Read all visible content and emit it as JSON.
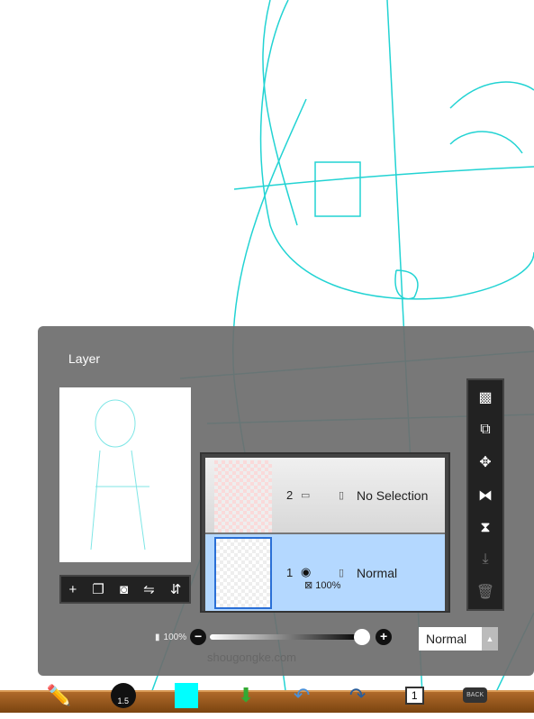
{
  "panel": {
    "title": "Layer"
  },
  "layers": [
    {
      "number": "2",
      "visibility_icon": "selection-rect-icon",
      "mode_icon": "page-icon",
      "name": "No Selection",
      "selected": false
    },
    {
      "number": "1",
      "visibility_icon": "eye-icon",
      "mode_icon": "page-icon",
      "name": "Normal",
      "opacity": "100%",
      "selected": true
    }
  ],
  "preview_tools": [
    "plus-icon",
    "copy-icon",
    "camera-icon",
    "flip-h-icon",
    "flip-v-icon"
  ],
  "side_tools": [
    "transparency-icon",
    "copy-layer-icon",
    "move-icon",
    "flip-horizontal-icon",
    "flip-vertical-icon",
    "merge-down-icon",
    "trash-icon"
  ],
  "opacity": {
    "label": "100%",
    "value": 100
  },
  "blend_mode": "Normal",
  "toolbar": {
    "brush_size": "1.5",
    "page_number": "1",
    "back_label": "BACK",
    "color": "#00ffff"
  },
  "watermark": "shougongke.com",
  "colors": {
    "stroke": "#22d3d3",
    "selected_row": "#b4d8ff"
  }
}
